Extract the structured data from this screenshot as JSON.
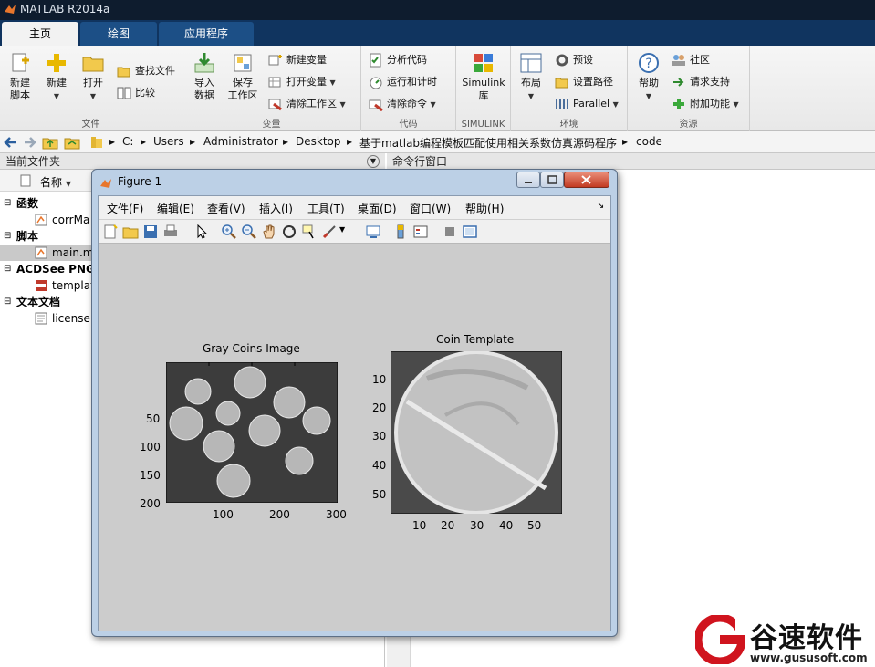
{
  "window": {
    "title": "MATLAB R2014a"
  },
  "tabs": [
    {
      "label": "主页",
      "active": true
    },
    {
      "label": "绘图",
      "active": false
    },
    {
      "label": "应用程序",
      "active": false
    }
  ],
  "ribbon": {
    "groups": {
      "file": "文件",
      "variable": "变量",
      "code": "代码",
      "simulink": "SIMULINK",
      "env": "环境",
      "resources": "资源"
    },
    "new_script": "新建\n脚本",
    "new_script_l1": "新建",
    "new_script_l2": "脚本",
    "new": "新建",
    "open": "打开",
    "find_files": "查找文件",
    "compare": "比较",
    "import_l1": "导入",
    "import_l2": "数据",
    "save_ws_l1": "保存",
    "save_ws_l2": "工作区",
    "new_var": "新建变量",
    "open_var": "打开变量",
    "clear_ws": "清除工作区",
    "analyze": "分析代码",
    "run_time": "运行和计时",
    "clear_cmd": "清除命令",
    "simulink_l1": "Simulink",
    "simulink_l2": "库",
    "layout": "布局",
    "prefs": "预设",
    "set_path": "设置路径",
    "parallel": "Parallel",
    "help": "帮助",
    "community": "社区",
    "support": "请求支持",
    "addons": "附加功能"
  },
  "path": [
    "C:",
    "Users",
    "Administrator",
    "Desktop",
    "基于matlab编程模板匹配使用相关系数仿真源码程序",
    "code"
  ],
  "panels": {
    "current_folder": "当前文件夹",
    "command_window": "命令行窗口",
    "name_col": "名称"
  },
  "tree": [
    {
      "label": "函数",
      "group": true
    },
    {
      "label": "corrMa",
      "group": false
    },
    {
      "label": "脚本",
      "group": true
    },
    {
      "label": "main.m",
      "group": false,
      "selected": true
    },
    {
      "label": "ACDSee PNG",
      "group": true
    },
    {
      "label": "templat",
      "group": false
    },
    {
      "label": "文本文档",
      "group": true
    },
    {
      "label": "license.",
      "group": false
    }
  ],
  "figure": {
    "title": "Figure 1",
    "menu": [
      "文件(F)",
      "编辑(E)",
      "查看(V)",
      "插入(I)",
      "工具(T)",
      "桌面(D)",
      "窗口(W)",
      "帮助(H)"
    ],
    "plot1": {
      "title": "Gray Coins Image",
      "xticks": [
        "100",
        "200",
        "300"
      ],
      "yticks": [
        "50",
        "100",
        "150",
        "200"
      ]
    },
    "plot2": {
      "title": "Coin Template",
      "xticks": [
        "10",
        "20",
        "30",
        "40",
        "50"
      ],
      "yticks": [
        "10",
        "20",
        "30",
        "40",
        "50"
      ]
    }
  },
  "watermark": {
    "name": "谷速软件",
    "url": "www.gususoft.com"
  }
}
